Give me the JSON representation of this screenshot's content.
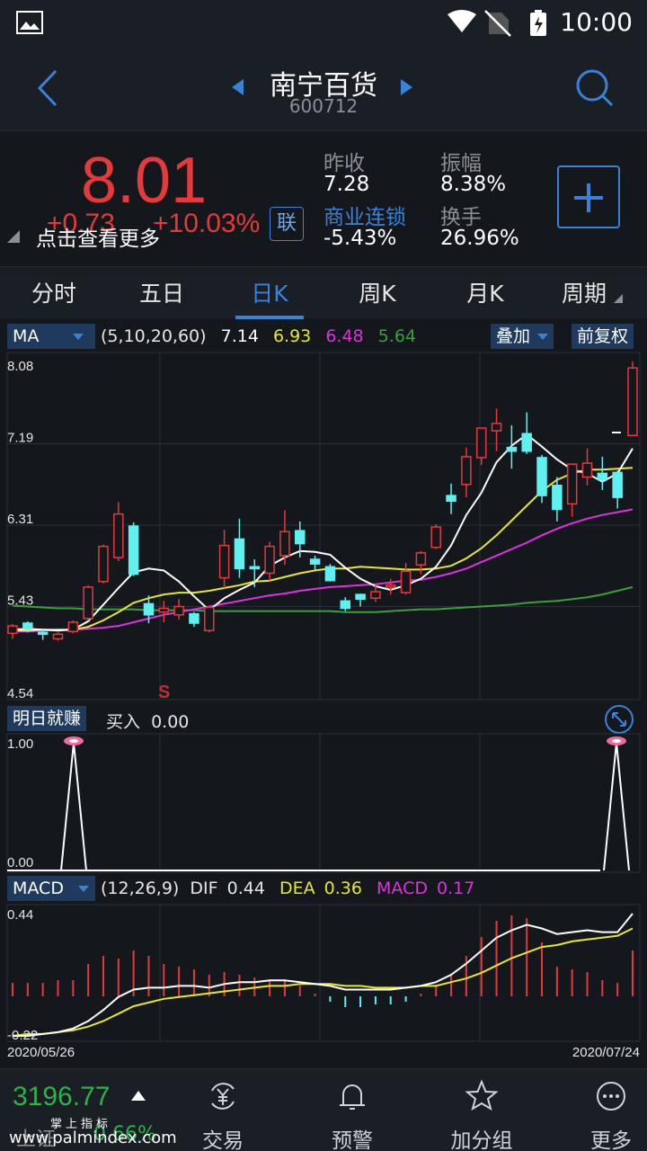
{
  "status": {
    "time": "10:00"
  },
  "header": {
    "stock_name": "南宁百货",
    "stock_code": "600712"
  },
  "quote": {
    "price": "8.01",
    "change": "+0.73",
    "change_pct": "+10.03%",
    "tip": "点击查看更多",
    "lian_label": "联",
    "stats": [
      {
        "label": "昨收",
        "value": "7.28",
        "label_color": "#8a8f98"
      },
      {
        "label": "振幅",
        "value": "8.38%",
        "label_color": "#8a8f98"
      },
      {
        "label": "商业连锁",
        "value": "-5.43%",
        "label_color": "#3a82d8"
      },
      {
        "label": "换手",
        "value": "26.96%",
        "label_color": "#8a8f98"
      }
    ]
  },
  "tabs": [
    "分时",
    "五日",
    "日K",
    "周K",
    "月K",
    "周期"
  ],
  "active_tab": 2,
  "indicators": {
    "ma": {
      "name": "MA",
      "params": "(5,10,20,60)",
      "v5": "7.14",
      "v10": "6.93",
      "v20": "6.48",
      "v60": "5.64"
    },
    "overlay_label": "叠加",
    "adjust_label": "前复权",
    "signal": {
      "name": "明日就赚",
      "buy_label": "买入",
      "buy_value": "0.00"
    },
    "macd": {
      "name": "MACD",
      "params": "(12,26,9)",
      "dif_label": "DIF",
      "dif": "0.44",
      "dea_label": "DEA",
      "dea": "0.36",
      "macd_label": "MACD",
      "macd": "0.17"
    }
  },
  "price_axis": [
    "8.08",
    "7.19",
    "6.31",
    "5.43",
    "4.54"
  ],
  "signal_axis": [
    "1.00",
    "0.00"
  ],
  "macd_axis": [
    "0.44",
    "-0.22"
  ],
  "date_range": {
    "start": "2020/05/26",
    "end": "2020/07/24"
  },
  "sell_marker": "S",
  "colors": {
    "up": "#e53a3a",
    "down": "#5ff0f0",
    "ma5": "#ffffff",
    "ma10": "#e8e82a",
    "ma20": "#e030e0",
    "ma60": "#3aa03a",
    "accent": "#3a82d8"
  },
  "chart_data": {
    "type": "candlestick",
    "ylim": [
      4.54,
      8.08
    ],
    "candles": [
      {
        "o": 5.14,
        "c": 5.22,
        "h": 5.24,
        "l": 5.08
      },
      {
        "o": 5.25,
        "c": 5.19,
        "h": 5.27,
        "l": 5.15
      },
      {
        "o": 5.15,
        "c": 5.13,
        "h": 5.19,
        "l": 5.07
      },
      {
        "o": 5.08,
        "c": 5.13,
        "h": 5.15,
        "l": 5.06
      },
      {
        "o": 5.16,
        "c": 5.26,
        "h": 5.28,
        "l": 5.14
      },
      {
        "o": 5.3,
        "c": 5.64,
        "h": 5.66,
        "l": 5.28
      },
      {
        "o": 5.7,
        "c": 6.08,
        "h": 6.1,
        "l": 5.68
      },
      {
        "o": 5.96,
        "c": 6.43,
        "h": 6.56,
        "l": 5.92
      },
      {
        "o": 6.3,
        "c": 5.78,
        "h": 6.34,
        "l": 5.76
      },
      {
        "o": 5.46,
        "c": 5.34,
        "h": 5.55,
        "l": 5.25
      },
      {
        "o": 5.37,
        "c": 5.41,
        "h": 5.49,
        "l": 5.26
      },
      {
        "o": 5.34,
        "c": 5.43,
        "h": 5.51,
        "l": 5.29
      },
      {
        "o": 5.35,
        "c": 5.25,
        "h": 5.37,
        "l": 5.21
      },
      {
        "o": 5.17,
        "c": 5.42,
        "h": 5.44,
        "l": 5.15
      },
      {
        "o": 5.74,
        "c": 6.09,
        "h": 6.26,
        "l": 5.63
      },
      {
        "o": 6.16,
        "c": 5.84,
        "h": 6.38,
        "l": 5.74
      },
      {
        "o": 5.86,
        "c": 5.85,
        "h": 5.94,
        "l": 5.64
      },
      {
        "o": 5.79,
        "c": 6.08,
        "h": 6.13,
        "l": 5.71
      },
      {
        "o": 5.98,
        "c": 6.24,
        "h": 6.47,
        "l": 5.88
      },
      {
        "o": 6.25,
        "c": 6.11,
        "h": 6.35,
        "l": 5.96
      },
      {
        "o": 5.94,
        "c": 5.89,
        "h": 5.98,
        "l": 5.83
      },
      {
        "o": 5.86,
        "c": 5.71,
        "h": 5.89,
        "l": 5.7
      },
      {
        "o": 5.49,
        "c": 5.41,
        "h": 5.53,
        "l": 5.38
      },
      {
        "o": 5.56,
        "c": 5.51,
        "h": 5.57,
        "l": 5.43
      },
      {
        "o": 5.52,
        "c": 5.59,
        "h": 5.66,
        "l": 5.48
      },
      {
        "o": 5.64,
        "c": 5.66,
        "h": 5.73,
        "l": 5.56
      },
      {
        "o": 5.58,
        "c": 5.81,
        "h": 5.9,
        "l": 5.56
      },
      {
        "o": 5.88,
        "c": 6.01,
        "h": 6.03,
        "l": 5.78
      },
      {
        "o": 6.07,
        "c": 6.29,
        "h": 6.32,
        "l": 6.05
      },
      {
        "o": 6.63,
        "c": 6.57,
        "h": 6.76,
        "l": 6.43
      },
      {
        "o": 6.75,
        "c": 7.05,
        "h": 7.15,
        "l": 6.61
      },
      {
        "o": 7.04,
        "c": 7.36,
        "h": 7.31,
        "l": 6.96
      },
      {
        "o": 7.33,
        "c": 7.41,
        "h": 7.57,
        "l": 7.11
      },
      {
        "o": 7.15,
        "c": 7.11,
        "h": 7.39,
        "l": 6.92
      },
      {
        "o": 7.3,
        "c": 7.11,
        "h": 7.53,
        "l": 7.08
      },
      {
        "o": 7.04,
        "c": 6.63,
        "h": 7.07,
        "l": 6.55
      },
      {
        "o": 6.74,
        "c": 6.48,
        "h": 6.83,
        "l": 6.35
      },
      {
        "o": 6.54,
        "c": 6.97,
        "h": 6.97,
        "l": 6.4
      },
      {
        "o": 6.83,
        "c": 6.98,
        "h": 7.14,
        "l": 6.74
      },
      {
        "o": 6.87,
        "c": 6.8,
        "h": 7.05,
        "l": 6.69
      },
      {
        "o": 6.88,
        "c": 6.61,
        "h": 6.9,
        "l": 6.49
      },
      {
        "o": 7.28,
        "c": 8.01,
        "h": 8.08,
        "l": 7.28
      }
    ],
    "ma5": [
      5.18,
      5.19,
      5.18,
      5.17,
      5.18,
      5.27,
      5.45,
      5.63,
      5.8,
      5.84,
      5.82,
      5.7,
      5.54,
      5.39,
      5.52,
      5.61,
      5.69,
      5.87,
      5.96,
      6.03,
      6.02,
      5.99,
      5.85,
      5.73,
      5.65,
      5.61,
      5.66,
      5.73,
      5.86,
      6.09,
      6.42,
      6.66,
      6.99,
      7.17,
      7.29,
      7.16,
      7.02,
      6.91,
      6.87,
      6.78,
      6.87,
      7.14
    ],
    "ma10": [
      5.17,
      5.17,
      5.18,
      5.18,
      5.18,
      5.21,
      5.28,
      5.37,
      5.47,
      5.52,
      5.56,
      5.58,
      5.58,
      5.6,
      5.63,
      5.66,
      5.7,
      5.71,
      5.75,
      5.79,
      5.82,
      5.84,
      5.84,
      5.86,
      5.85,
      5.84,
      5.83,
      5.83,
      5.84,
      5.87,
      5.95,
      6.06,
      6.2,
      6.36,
      6.52,
      6.68,
      6.8,
      6.87,
      6.91,
      6.91,
      6.92,
      6.93
    ],
    "ma20": [
      5.16,
      5.16,
      5.17,
      5.18,
      5.18,
      5.19,
      5.2,
      5.22,
      5.26,
      5.3,
      5.34,
      5.37,
      5.4,
      5.43,
      5.46,
      5.49,
      5.52,
      5.55,
      5.57,
      5.6,
      5.62,
      5.64,
      5.65,
      5.66,
      5.67,
      5.69,
      5.71,
      5.72,
      5.75,
      5.79,
      5.84,
      5.91,
      5.98,
      6.05,
      6.12,
      6.2,
      6.27,
      6.33,
      6.38,
      6.42,
      6.45,
      6.48
    ],
    "ma60": [
      5.44,
      5.43,
      5.42,
      5.41,
      5.41,
      5.4,
      5.4,
      5.4,
      5.4,
      5.39,
      5.39,
      5.39,
      5.39,
      5.38,
      5.38,
      5.38,
      5.38,
      5.38,
      5.38,
      5.38,
      5.38,
      5.38,
      5.37,
      5.37,
      5.37,
      5.38,
      5.39,
      5.4,
      5.4,
      5.41,
      5.42,
      5.43,
      5.44,
      5.45,
      5.47,
      5.48,
      5.49,
      5.51,
      5.53,
      5.56,
      5.6,
      5.64
    ],
    "signal_series": [
      1,
      0,
      0,
      0,
      0,
      0,
      0,
      0,
      0,
      0,
      0,
      0,
      0,
      0,
      0,
      0,
      0,
      0,
      0,
      0,
      0,
      0,
      0,
      0,
      0,
      0,
      0,
      0,
      0,
      0,
      0,
      0,
      0,
      0,
      0,
      0,
      0,
      0,
      0,
      0,
      1,
      0
    ],
    "macd_ylim": [
      -0.22,
      0.44
    ],
    "dif": [
      -0.22,
      -0.22,
      -0.21,
      -0.2,
      -0.18,
      -0.14,
      -0.08,
      -0.01,
      0.03,
      0.04,
      0.04,
      0.05,
      0.05,
      0.04,
      0.06,
      0.07,
      0.07,
      0.08,
      0.08,
      0.07,
      0.06,
      0.05,
      0.03,
      0.03,
      0.03,
      0.03,
      0.04,
      0.05,
      0.07,
      0.11,
      0.17,
      0.24,
      0.31,
      0.35,
      0.38,
      0.36,
      0.33,
      0.34,
      0.35,
      0.34,
      0.34,
      0.44
    ],
    "dea": [
      -0.22,
      -0.21,
      -0.21,
      -0.2,
      -0.19,
      -0.17,
      -0.14,
      -0.1,
      -0.06,
      -0.04,
      -0.02,
      -0.01,
      0.0,
      0.01,
      0.02,
      0.03,
      0.04,
      0.05,
      0.05,
      0.06,
      0.06,
      0.06,
      0.05,
      0.05,
      0.04,
      0.04,
      0.04,
      0.05,
      0.05,
      0.07,
      0.09,
      0.12,
      0.16,
      0.2,
      0.23,
      0.26,
      0.27,
      0.29,
      0.3,
      0.31,
      0.32,
      0.36
    ],
    "macd": [
      0.05,
      0.05,
      0.05,
      0.06,
      0.06,
      0.12,
      0.15,
      0.14,
      0.17,
      0.15,
      0.12,
      0.11,
      0.1,
      0.08,
      0.09,
      0.08,
      0.07,
      0.06,
      0.06,
      0.04,
      0.01,
      -0.02,
      -0.04,
      -0.04,
      -0.03,
      -0.03,
      -0.02,
      0.01,
      0.04,
      0.08,
      0.15,
      0.22,
      0.28,
      0.3,
      0.29,
      0.2,
      0.11,
      0.1,
      0.09,
      0.06,
      0.05,
      0.17
    ]
  },
  "bottom_nav": {
    "index_value": "3196.77",
    "index_name": "上证",
    "index_pct": "0.66%",
    "watermark": "www.palmindex.com",
    "watermark_cn": "掌上指标",
    "items": [
      "交易",
      "预警",
      "加分组",
      "更多"
    ]
  }
}
